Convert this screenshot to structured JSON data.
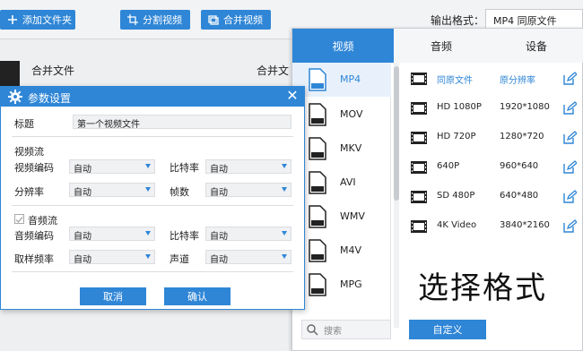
{
  "toolbar": {
    "add_folder": "添加文件夹",
    "split_video": "分割视频",
    "merge_video": "合并视频",
    "output_label": "输出格式：",
    "output_value": "MP4  同原文件"
  },
  "background": {
    "merge_file_1": "合并文件",
    "merge_file_2": "合并文"
  },
  "dialog": {
    "title": "参数设置",
    "title_label": "标题",
    "title_value": "第一个视频文件",
    "video_section": "视频流",
    "video_codec_label": "视频编码",
    "video_codec_value": "自动",
    "bitrate_label": "比特率",
    "bitrate_value": "自动",
    "resolution_label": "分辨率",
    "resolution_value": "自动",
    "fps_label": "帧数",
    "fps_value": "自动",
    "audio_section": "音频流",
    "audio_codec_label": "音频编码",
    "audio_codec_value": "自动",
    "audio_bitrate_label": "比特率",
    "audio_bitrate_value": "自动",
    "sample_label": "取样频率",
    "sample_value": "自动",
    "channel_label": "声道",
    "channel_value": "自动",
    "cancel": "取消",
    "confirm": "确认"
  },
  "panel": {
    "tabs": [
      "视频",
      "音频",
      "设备"
    ],
    "formats": [
      "MP4",
      "MOV",
      "MKV",
      "AVI",
      "WMV",
      "M4V",
      "MPG"
    ],
    "resolutions": [
      {
        "name": "同原文件",
        "dim": "原分辨率"
      },
      {
        "name": "HD 1080P",
        "dim": "1920*1080"
      },
      {
        "name": "HD 720P",
        "dim": "1280*720"
      },
      {
        "name": "640P",
        "dim": "960*640"
      },
      {
        "name": "SD 480P",
        "dim": "640*480"
      },
      {
        "name": "4K Video",
        "dim": "3840*2160"
      }
    ],
    "search_placeholder": "搜索",
    "custom": "自定义",
    "overlay_text": "选择格式"
  },
  "colors": {
    "accent": "#2f86d6"
  }
}
